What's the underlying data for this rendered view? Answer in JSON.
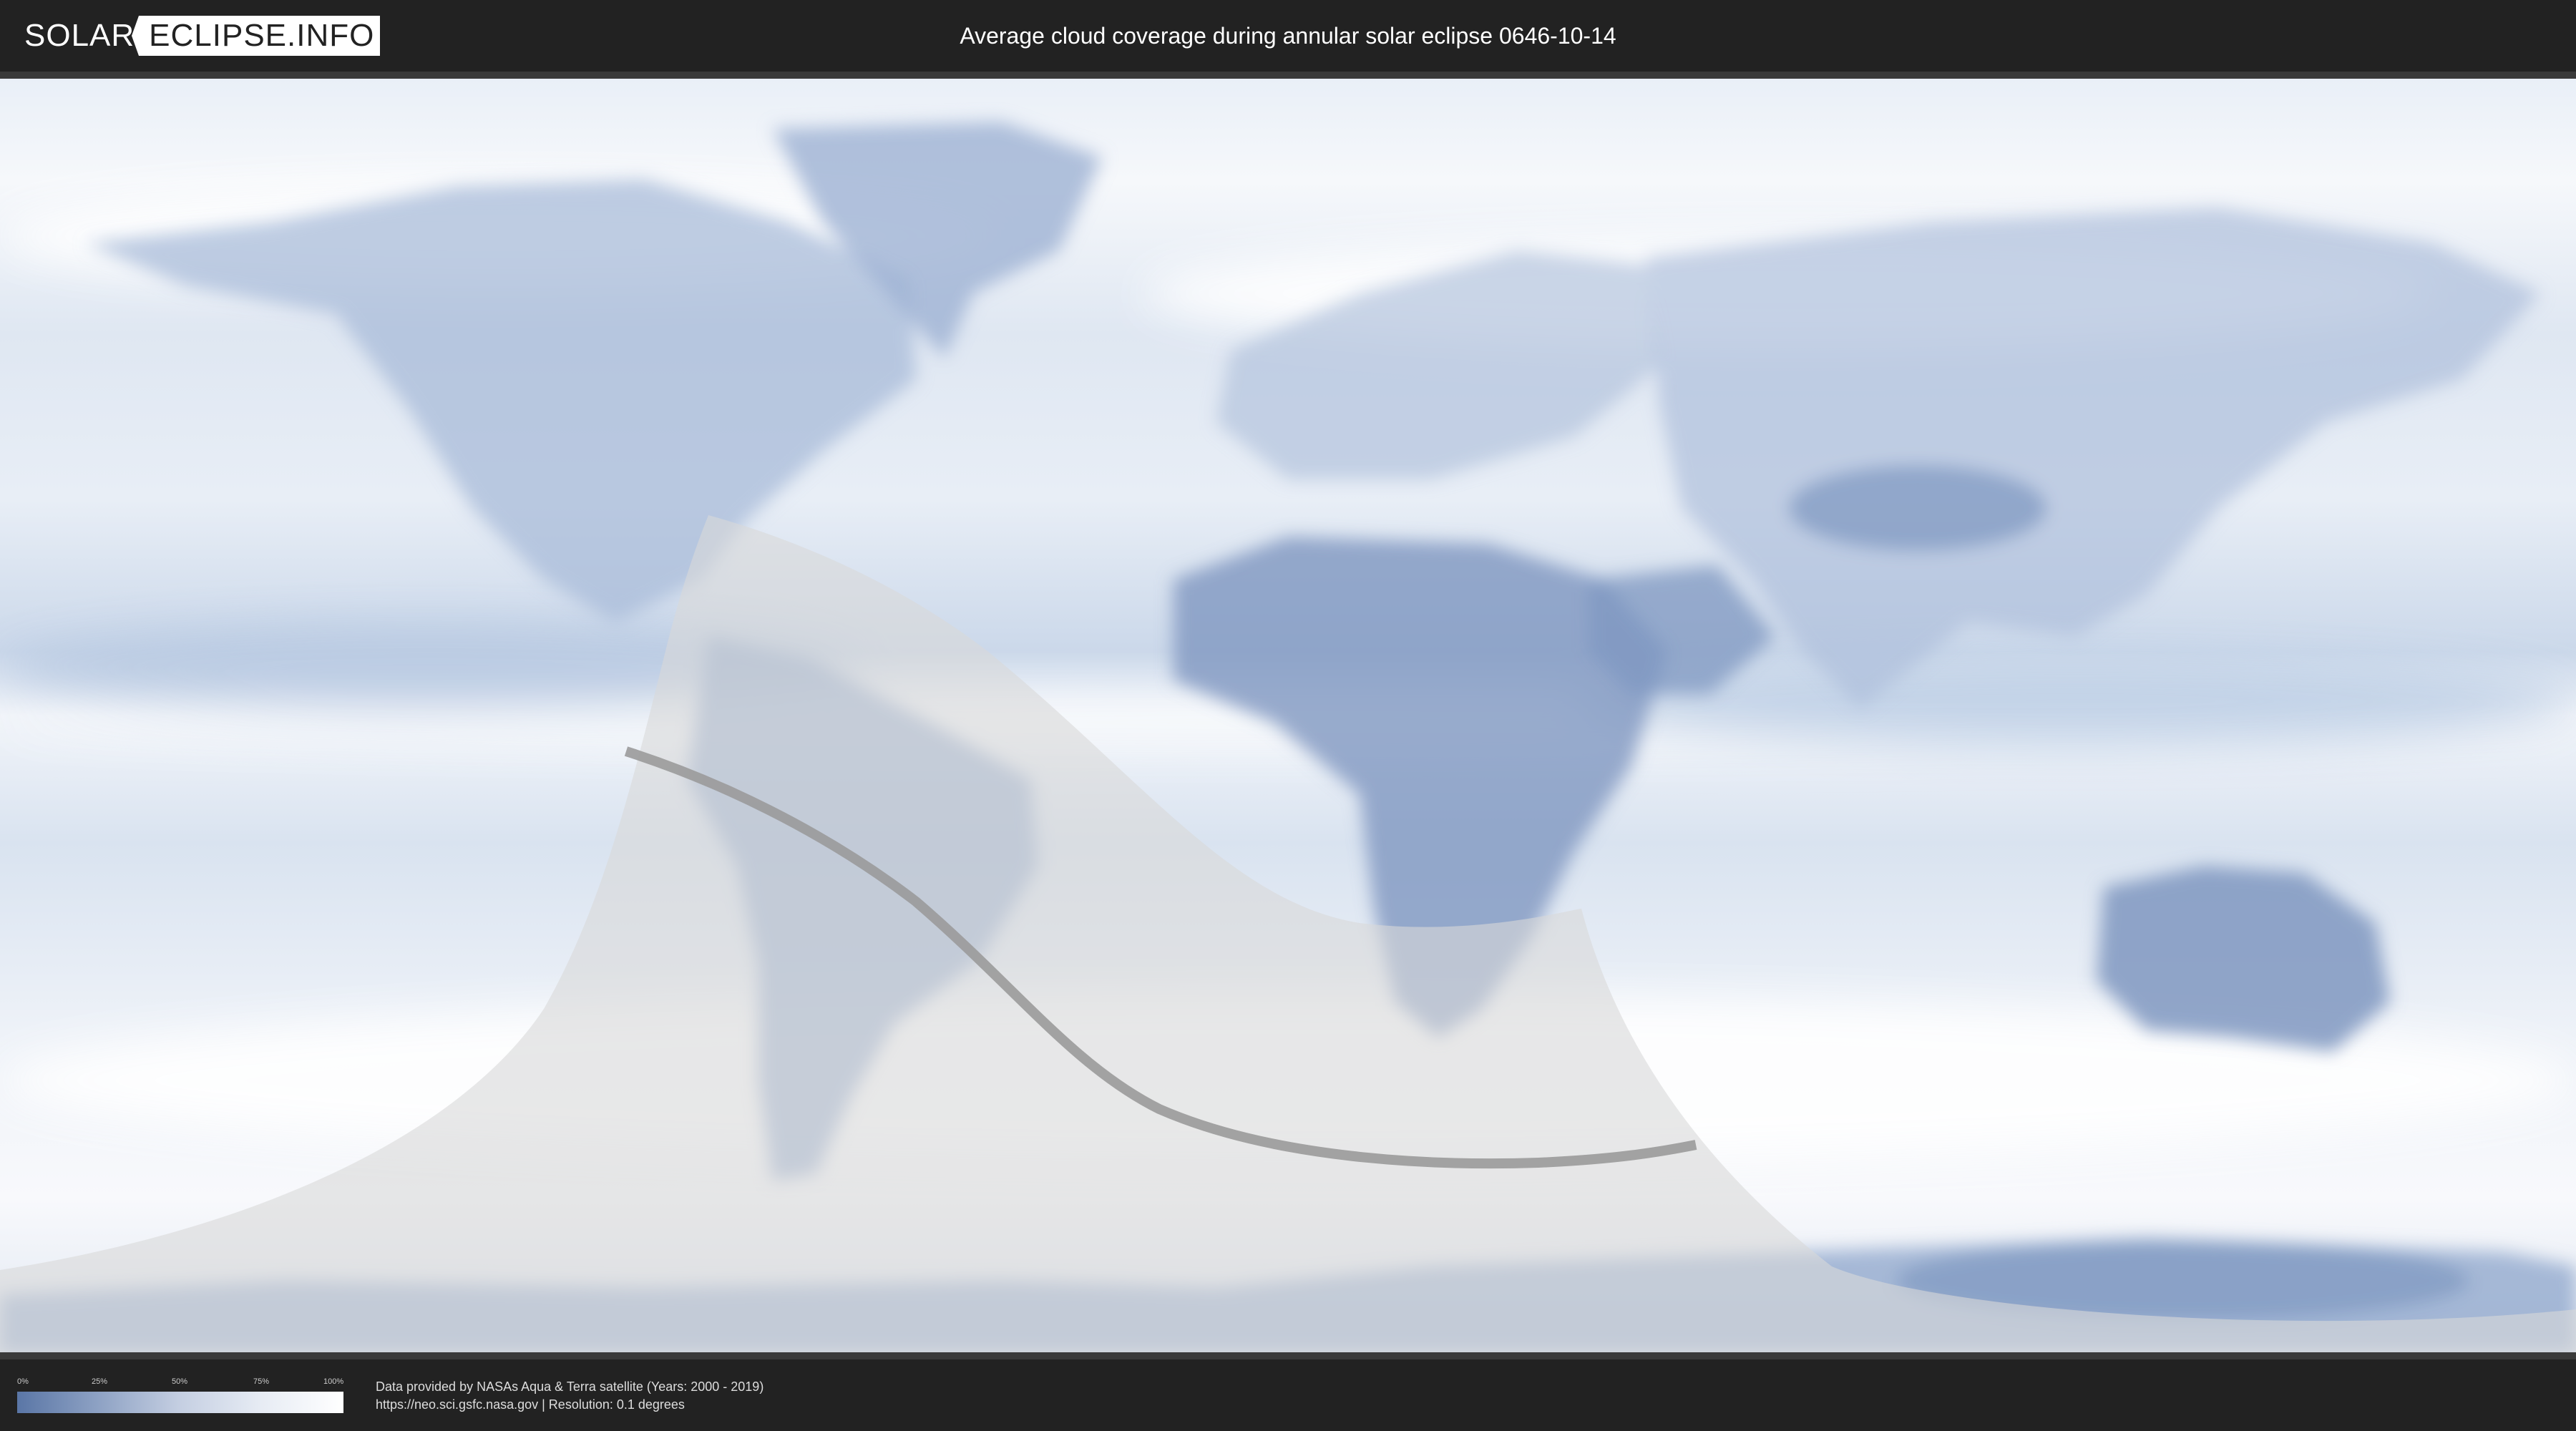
{
  "header": {
    "logo_left": "SOLAR",
    "logo_right": "ECLIPSE.INFO",
    "title": "Average cloud coverage during annular solar eclipse 0646-10-14"
  },
  "legend": {
    "ticks": [
      "0%",
      "25%",
      "50%",
      "75%",
      "100%"
    ],
    "colors": [
      "#5a76a6",
      "#8ea2c4",
      "#c5cfe2",
      "#e7ecf4",
      "#ffffff"
    ]
  },
  "footer": {
    "credit_line_1": "Data provided by NASAs Aqua & Terra satellite (Years: 2000 - 2019)",
    "credit_line_2": "https://neo.sci.gsfc.nasa.gov | Resolution: 0.1 degrees"
  },
  "map": {
    "projection": "equirectangular world map",
    "colors": {
      "ocean_clear": "#cfdcee",
      "cloudy": "#f4f6fa",
      "land_clear": "#7f97c0",
      "eclipse_overlay": "#d8d8d8",
      "central_line": "#9a9a9a"
    }
  }
}
